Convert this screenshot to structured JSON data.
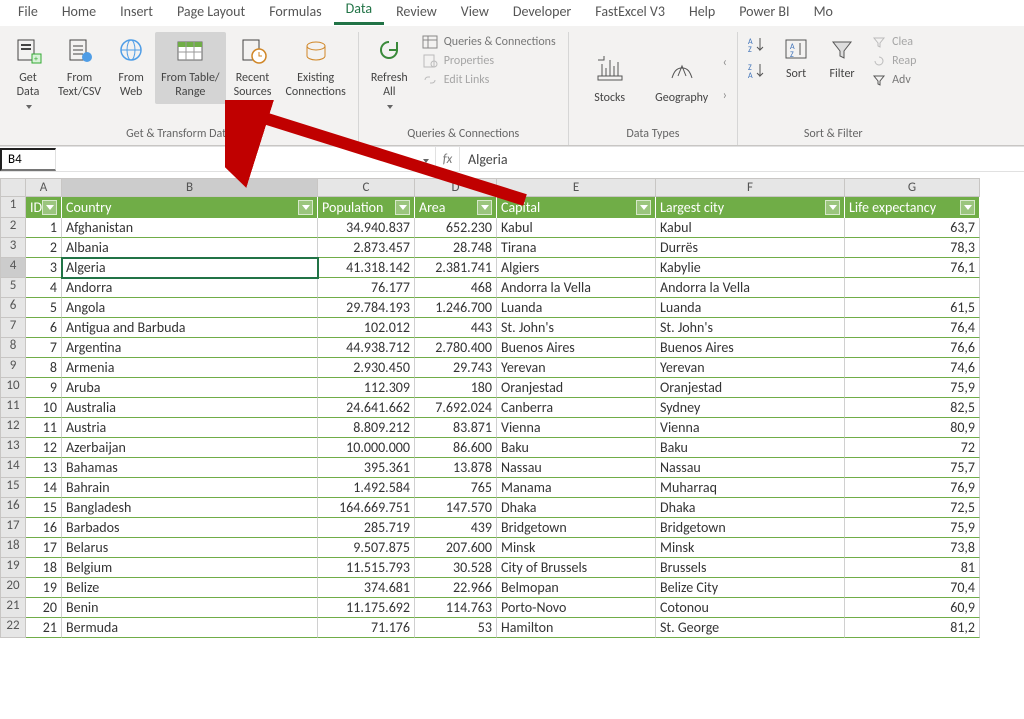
{
  "tabs": [
    "File",
    "Home",
    "Insert",
    "Page Layout",
    "Formulas",
    "Data",
    "Review",
    "View",
    "Developer",
    "FastExcel V3",
    "Help",
    "Power BI",
    "Mo"
  ],
  "active_tab": "Data",
  "ribbon": {
    "get_transform": {
      "label": "Get & Transform Data",
      "buttons": {
        "get_data": "Get\nData",
        "from_text": "From\nText/CSV",
        "from_web": "From\nWeb",
        "from_table": "From Table/\nRange",
        "recent": "Recent\nSources",
        "existing": "Existing\nConnections"
      }
    },
    "queries": {
      "label": "Queries & Connections",
      "refresh": "Refresh\nAll",
      "items": {
        "qc": "Queries & Connections",
        "props": "Properties",
        "links": "Edit Links"
      }
    },
    "data_types": {
      "label": "Data Types",
      "stocks": "Stocks",
      "geo": "Geography"
    },
    "sort_filter": {
      "label": "Sort & Filter",
      "sort": "Sort",
      "filter": "Filter",
      "clear": "Clea",
      "reapply": "Reap",
      "adv": "Adv"
    }
  },
  "name_box": "B4",
  "formula_bar": "Algeria",
  "columns": [
    "A",
    "B",
    "C",
    "D",
    "E",
    "F",
    "G"
  ],
  "headers": [
    "ID",
    "Country",
    "Population",
    "Area",
    "Capital",
    "Largest city",
    "Life expectancy"
  ],
  "rows": [
    {
      "id": 1,
      "c": "Afghanistan",
      "p": "34.940.837",
      "a": "652.230",
      "cap": "Kabul",
      "lc": "Kabul",
      "le": "63,7"
    },
    {
      "id": 2,
      "c": "Albania",
      "p": "2.873.457",
      "a": "28.748",
      "cap": "Tirana",
      "lc": "Durrës",
      "le": "78,3"
    },
    {
      "id": 3,
      "c": "Algeria",
      "p": "41.318.142",
      "a": "2.381.741",
      "cap": "Algiers",
      "lc": "Kabylie",
      "le": "76,1"
    },
    {
      "id": 4,
      "c": "Andorra",
      "p": "76.177",
      "a": "468",
      "cap": "Andorra la Vella",
      "lc": "Andorra la Vella",
      "le": ""
    },
    {
      "id": 5,
      "c": "Angola",
      "p": "29.784.193",
      "a": "1.246.700",
      "cap": "Luanda",
      "lc": "Luanda",
      "le": "61,5"
    },
    {
      "id": 6,
      "c": "Antigua and Barbuda",
      "p": "102.012",
      "a": "443",
      "cap": "St. John's",
      "lc": "St. John's",
      "le": "76,4"
    },
    {
      "id": 7,
      "c": "Argentina",
      "p": "44.938.712",
      "a": "2.780.400",
      "cap": "Buenos Aires",
      "lc": "Buenos Aires",
      "le": "76,6"
    },
    {
      "id": 8,
      "c": "Armenia",
      "p": "2.930.450",
      "a": "29.743",
      "cap": "Yerevan",
      "lc": "Yerevan",
      "le": "74,6"
    },
    {
      "id": 9,
      "c": "Aruba",
      "p": "112.309",
      "a": "180",
      "cap": "Oranjestad",
      "lc": "Oranjestad",
      "le": "75,9"
    },
    {
      "id": 10,
      "c": "Australia",
      "p": "24.641.662",
      "a": "7.692.024",
      "cap": "Canberra",
      "lc": "Sydney",
      "le": "82,5"
    },
    {
      "id": 11,
      "c": "Austria",
      "p": "8.809.212",
      "a": "83.871",
      "cap": "Vienna",
      "lc": "Vienna",
      "le": "80,9"
    },
    {
      "id": 12,
      "c": "Azerbaijan",
      "p": "10.000.000",
      "a": "86.600",
      "cap": "Baku",
      "lc": "Baku",
      "le": "72"
    },
    {
      "id": 13,
      "c": "Bahamas",
      "p": "395.361",
      "a": "13.878",
      "cap": "Nassau",
      "lc": "Nassau",
      "le": "75,7"
    },
    {
      "id": 14,
      "c": "Bahrain",
      "p": "1.492.584",
      "a": "765",
      "cap": "Manama",
      "lc": "Muharraq",
      "le": "76,9"
    },
    {
      "id": 15,
      "c": "Bangladesh",
      "p": "164.669.751",
      "a": "147.570",
      "cap": "Dhaka",
      "lc": "Dhaka",
      "le": "72,5"
    },
    {
      "id": 16,
      "c": "Barbados",
      "p": "285.719",
      "a": "439",
      "cap": "Bridgetown",
      "lc": "Bridgetown",
      "le": "75,9"
    },
    {
      "id": 17,
      "c": "Belarus",
      "p": "9.507.875",
      "a": "207.600",
      "cap": "Minsk",
      "lc": "Minsk",
      "le": "73,8"
    },
    {
      "id": 18,
      "c": "Belgium",
      "p": "11.515.793",
      "a": "30.528",
      "cap": "City of Brussels",
      "lc": "Brussels",
      "le": "81"
    },
    {
      "id": 19,
      "c": "Belize",
      "p": "374.681",
      "a": "22.966",
      "cap": "Belmopan",
      "lc": "Belize City",
      "le": "70,4"
    },
    {
      "id": 20,
      "c": "Benin",
      "p": "11.175.692",
      "a": "114.763",
      "cap": "Porto-Novo",
      "lc": "Cotonou",
      "le": "60,9"
    },
    {
      "id": 21,
      "c": "Bermuda",
      "p": "71.176",
      "a": "53",
      "cap": "Hamilton",
      "lc": "St. George",
      "le": "81,2"
    }
  ],
  "selected_cell": {
    "row": 3,
    "col": "B"
  }
}
